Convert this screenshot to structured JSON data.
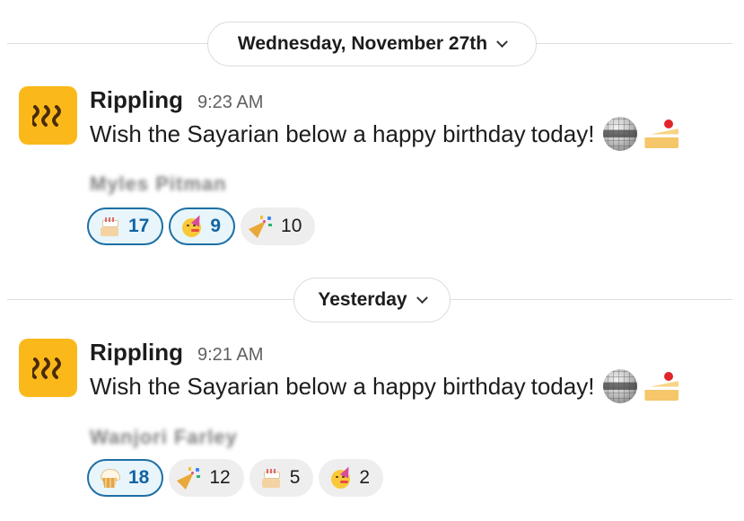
{
  "sections": [
    {
      "date_label": "Wednesday, November 27th",
      "message": {
        "sender": "Rippling",
        "time": "9:23 AM",
        "text": "Wish the Sayarian below a happy birthday",
        "text_tail": "today!",
        "inline_emojis": [
          "mirror-ball-icon",
          "shortcake-icon"
        ],
        "mention_name": "Myles Pitman",
        "reactions": [
          {
            "emoji": "birthday-cake-icon",
            "count": "17",
            "mine": true
          },
          {
            "emoji": "partying-face-icon",
            "count": "9",
            "mine": true
          },
          {
            "emoji": "tada-icon",
            "count": "10",
            "mine": false
          }
        ]
      }
    },
    {
      "date_label": "Yesterday",
      "message": {
        "sender": "Rippling",
        "time": "9:21 AM",
        "text": "Wish the Sayarian below a happy birthday",
        "text_tail": "today!",
        "inline_emojis": [
          "mirror-ball-icon",
          "shortcake-icon"
        ],
        "mention_name": "Wanjori Farley",
        "reactions": [
          {
            "emoji": "cupcake-icon",
            "count": "18",
            "mine": true
          },
          {
            "emoji": "tada-icon",
            "count": "12",
            "mine": false
          },
          {
            "emoji": "birthday-cake-icon",
            "count": "5",
            "mine": false
          },
          {
            "emoji": "partying-face-icon",
            "count": "2",
            "mine": false
          }
        ]
      }
    }
  ],
  "colors": {
    "avatar_bg": "#fbb81b",
    "reaction_mine_border": "#1d6fa5",
    "reaction_mine_bg": "#e8f5fa",
    "reaction_bg": "#eeeeee"
  }
}
